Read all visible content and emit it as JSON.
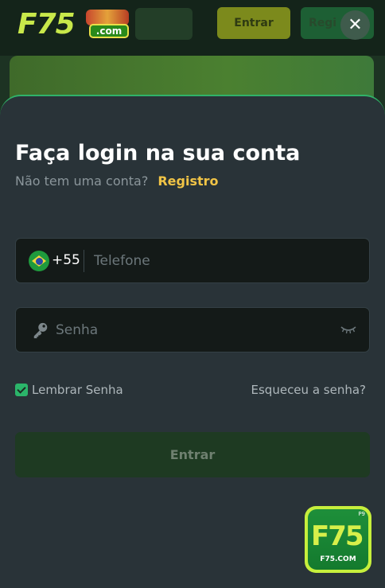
{
  "background": {
    "logo_text": "F75",
    "logo_domain": ".com",
    "header_button_1": "Entrar",
    "header_button_2": "Regi"
  },
  "modal": {
    "close_symbol": "✕",
    "title": "Faça login na sua conta",
    "no_account_text": "Não tem uma conta?",
    "register_link": "Registro",
    "phone": {
      "country_code": "+55",
      "placeholder": "Telefone",
      "flag": "brazil-flag-icon"
    },
    "password": {
      "placeholder": "Senha",
      "icon": "key-icon",
      "toggle_icon": "eye-closed-icon"
    },
    "remember_label": "Lembrar Senha",
    "remember_checked": true,
    "forgot_link": "Esqueceu a senha?",
    "submit_label": "Entrar"
  },
  "floating_badge": {
    "main_text": "F75",
    "sub_text": "F75.COM",
    "tag": "P9"
  },
  "colors": {
    "accent_green": "#30b269",
    "link_yellow": "#f1c446",
    "sheet_bg": "#293338",
    "field_bg": "#141a18",
    "submit_bg": "#1e3a22"
  }
}
